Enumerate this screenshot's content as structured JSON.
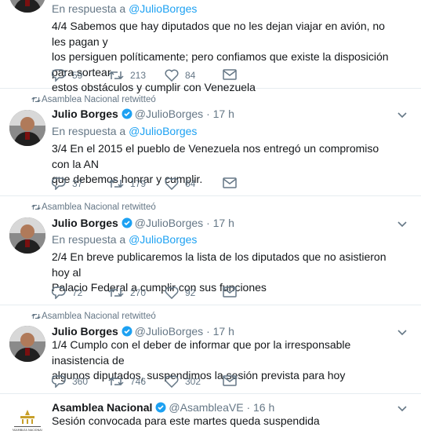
{
  "tweets": [
    {
      "reply_prefix": "En respuesta a",
      "reply_handle": "@JulioBorges",
      "text_lines": [
        "4/4 Sabemos que hay diputados que no les dejan viajar en avión, no les pagan y",
        "los persiguen políticamente; pero confiamos que existe la disposición para sortear",
        "estos obstáculos y cumplir con Venezuela"
      ],
      "replies": "59",
      "retweets": "213",
      "likes": "84"
    },
    {
      "retweeted_by": "Asamblea Nacional retwitteó",
      "name": "Julio Borges",
      "handle": "@JulioBorges",
      "dot": "·",
      "time": "17 h",
      "reply_prefix": "En respuesta a",
      "reply_handle": "@JulioBorges",
      "text_lines": [
        "3/4 En el 2015 el pueblo de Venezuela nos entregó un compromiso con la AN",
        "que  debemos honrar y cumplir."
      ],
      "replies": "37",
      "retweets": "179",
      "likes": "64"
    },
    {
      "retweeted_by": "Asamblea Nacional retwitteó",
      "name": "Julio Borges",
      "handle": "@JulioBorges",
      "dot": "·",
      "time": "17 h",
      "reply_prefix": "En respuesta a",
      "reply_handle": "@JulioBorges",
      "text_lines": [
        "2/4 En breve publicaremos la lista de los diputados que no asistieron hoy al",
        "Palacio Federal a cumplir con sus funciones"
      ],
      "replies": "72",
      "retweets": "270",
      "likes": "92"
    },
    {
      "retweeted_by": "Asamblea Nacional retwitteó",
      "name": "Julio Borges",
      "handle": "@JulioBorges",
      "dot": "·",
      "time": "17 h",
      "text_lines": [
        "1/4 Cumplo con el deber de informar que por la irresponsable inasistencia de",
        "algunos diputados, suspendimos la sesión prevista para hoy"
      ],
      "replies": "360",
      "retweets": "746",
      "likes": "302"
    },
    {
      "name": "Asamblea Nacional",
      "handle": "@AsambleaVE",
      "dot": "·",
      "time": "16 h",
      "text_lines": [
        "Sesión convocada para este martes queda suspendida"
      ],
      "logo_text": "ASAMBLEA NACIONAL"
    }
  ],
  "colors": {
    "link": "#1da1f2",
    "muted": "#657786",
    "verified": "#1da1f2",
    "divider": "#e6ecf0"
  },
  "icons": [
    "retweet-icon",
    "reply-icon",
    "like-icon",
    "direct-message-icon",
    "verified-badge-icon",
    "chevron-down-icon"
  ]
}
